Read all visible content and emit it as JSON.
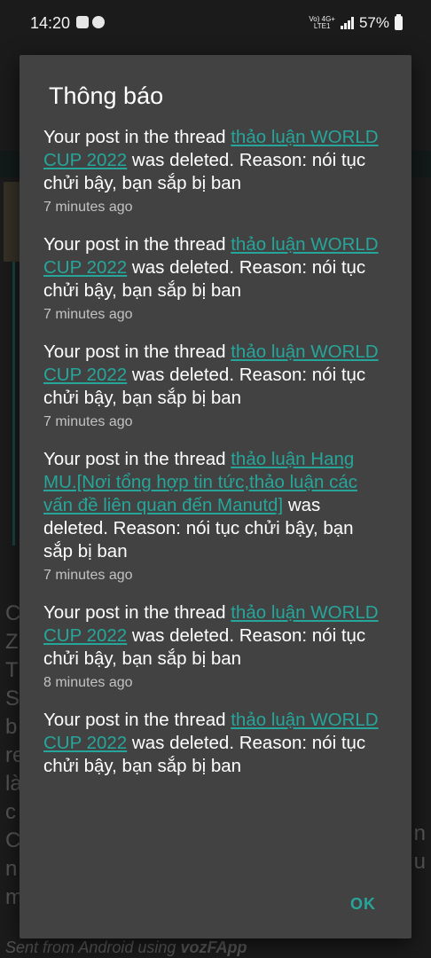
{
  "status_bar": {
    "time": "14:20",
    "network_top": "Vo) 4G+",
    "network_bottom": "LTE1",
    "battery": "57%"
  },
  "background": {
    "left_letters": [
      "C",
      "Z",
      "T",
      "S",
      "b",
      "re",
      "là",
      "c",
      "C",
      "n",
      "m"
    ],
    "right_letters": [
      "n",
      "u"
    ],
    "footer_prefix": "Sent from Android using ",
    "footer_app": "vozFApp"
  },
  "dialog": {
    "title": "Thông báo",
    "ok_label": "OK",
    "accent_color": "#26a69a",
    "notifications": [
      {
        "prefix": "Your post in the thread ",
        "link": "thảo luận WORLD CUP 2022",
        "suffix": " was deleted. Reason: nói tục chửi bậy, bạn sắp bị ban",
        "time": "7 minutes ago"
      },
      {
        "prefix": "Your post in the thread ",
        "link": "thảo luận WORLD CUP 2022",
        "suffix": " was deleted. Reason: nói tục chửi bậy, bạn sắp bị ban",
        "time": "7 minutes ago"
      },
      {
        "prefix": "Your post in the thread ",
        "link": "thảo luận WORLD CUP 2022",
        "suffix": " was deleted. Reason: nói tục chửi bậy, bạn sắp bị ban",
        "time": "7 minutes ago"
      },
      {
        "prefix": "Your post in the thread ",
        "link": "thảo luận Hang MU.[Nơi tổng hợp tin tức,thảo luận các vấn đề liên quan đến Manutd]",
        "suffix": " was deleted. Reason: nói tục chửi bậy, bạn sắp bị ban",
        "time": "7 minutes ago"
      },
      {
        "prefix": "Your post in the thread ",
        "link": "thảo luận WORLD CUP 2022",
        "suffix": " was deleted. Reason: nói tục chửi bậy, bạn sắp bị ban",
        "time": "8 minutes ago"
      },
      {
        "prefix": "Your post in the thread ",
        "link": "thảo luận WORLD CUP 2022",
        "suffix": " was deleted. Reason: nói tục chửi bậy, bạn sắp bị ban",
        "time": ""
      }
    ]
  }
}
